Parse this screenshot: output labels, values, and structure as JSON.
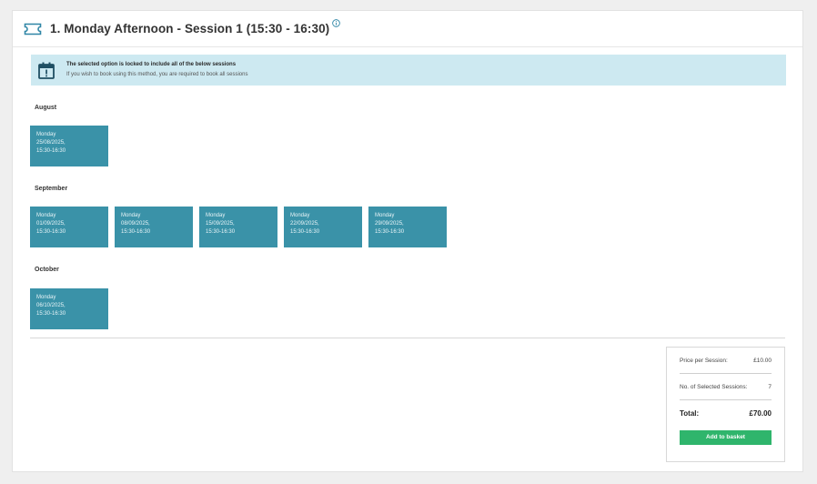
{
  "header": {
    "title": "1. Monday Afternoon - Session 1 (15:30 - 16:30)"
  },
  "alert": {
    "title": "The selected option is locked to include all of the below sessions",
    "subtitle": "If you wish to book using this method, you are required to book all sessions"
  },
  "months": [
    {
      "name": "August",
      "sessions": [
        {
          "day": "Monday",
          "date": "25/08/2025,",
          "time": "15:30-16:30"
        }
      ]
    },
    {
      "name": "September",
      "sessions": [
        {
          "day": "Monday",
          "date": "01/09/2025,",
          "time": "15:30-16:30"
        },
        {
          "day": "Monday",
          "date": "08/09/2025,",
          "time": "15:30-16:30"
        },
        {
          "day": "Monday",
          "date": "15/09/2025,",
          "time": "15:30-16:30"
        },
        {
          "day": "Monday",
          "date": "22/09/2025,",
          "time": "15:30-16:30"
        },
        {
          "day": "Monday",
          "date": "29/09/2025,",
          "time": "15:30-16:30"
        }
      ]
    },
    {
      "name": "October",
      "sessions": [
        {
          "day": "Monday",
          "date": "06/10/2025,",
          "time": "15:30-16:30"
        }
      ]
    }
  ],
  "summary": {
    "price_label": "Price per Session:",
    "price_value": "£10.00",
    "count_label": "No. of Selected Sessions:",
    "count_value": "7",
    "total_label": "Total:",
    "total_value": "£70.00",
    "button_label": "Add to basket"
  },
  "colors": {
    "accent": "#2f86a6",
    "session_tile": "#3a92a8",
    "alert_bg": "#cde9f1",
    "button": "#2fb56c"
  },
  "icons": {
    "header": "ticket-icon",
    "info": "info-icon",
    "alert": "calendar-alert-icon"
  }
}
